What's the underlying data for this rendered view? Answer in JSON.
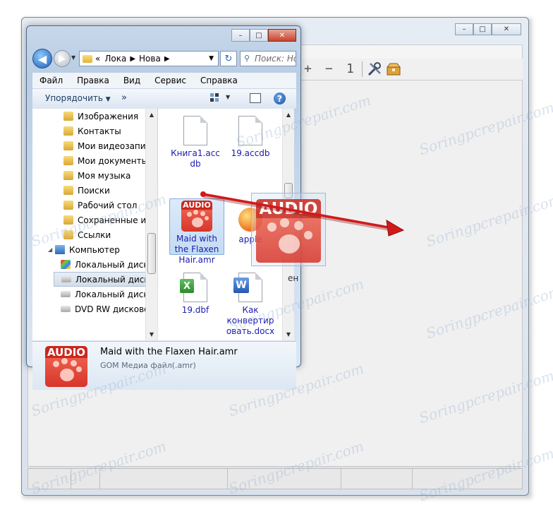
{
  "player": {
    "toolbar": {
      "plus": "+",
      "minus": "−",
      "one": "1"
    }
  },
  "explorer": {
    "address": {
      "seg1": "«",
      "seg2": "Лока",
      "seg3": "Нова"
    },
    "search_placeholder": "Поиск: Нов",
    "menu": [
      "Файл",
      "Правка",
      "Вид",
      "Сервис",
      "Справка"
    ],
    "commands": {
      "organize": "Упорядочить",
      "more": "»"
    },
    "tree": [
      "Изображения",
      "Контакты",
      "Мои видеозаписи",
      "Мои документы",
      "Моя музыка",
      "Поиски",
      "Рабочий стол",
      "Сохраненные игры",
      "Ссылки",
      "Компьютер",
      "Локальный диск (",
      "Локальный диск (",
      "Локальный диск (",
      "DVD RW дисковод"
    ],
    "files": [
      "Книга1.accdb",
      "19.accdb",
      "Maid with the Flaxen Hair.amr",
      "apple",
      "19.dbf",
      "Как конвертировать.docx"
    ],
    "file_labels": {
      "kniga1_line1": "Книга1.acc",
      "kniga1_line2": "db",
      "accdb_line1": "19.accdb",
      "amr_line1": "Maid with",
      "amr_line2": "the Flaxen",
      "amr_line3": "Hair.amr",
      "apple_line1": "apple",
      "dbf_line1": "19.dbf",
      "docx_line1": "Как",
      "docx_line2": "конвертир",
      "docx_line3": "овать.docx"
    },
    "details": {
      "name": "Maid with the Flaxen Hair.amr",
      "type": "GOM Медиа файл(.amr)"
    }
  },
  "icons": {
    "audio_tag": "AUDIO",
    "excel_letter": "X",
    "word_letter": "W",
    "help": "?"
  },
  "drag": {
    "partial_label": "ен"
  },
  "watermark": "Soringpcrepair.com",
  "colors": {
    "arrow": "#d21919",
    "audio_icon": "#e0412f",
    "link_text": "#1a1ab0"
  }
}
